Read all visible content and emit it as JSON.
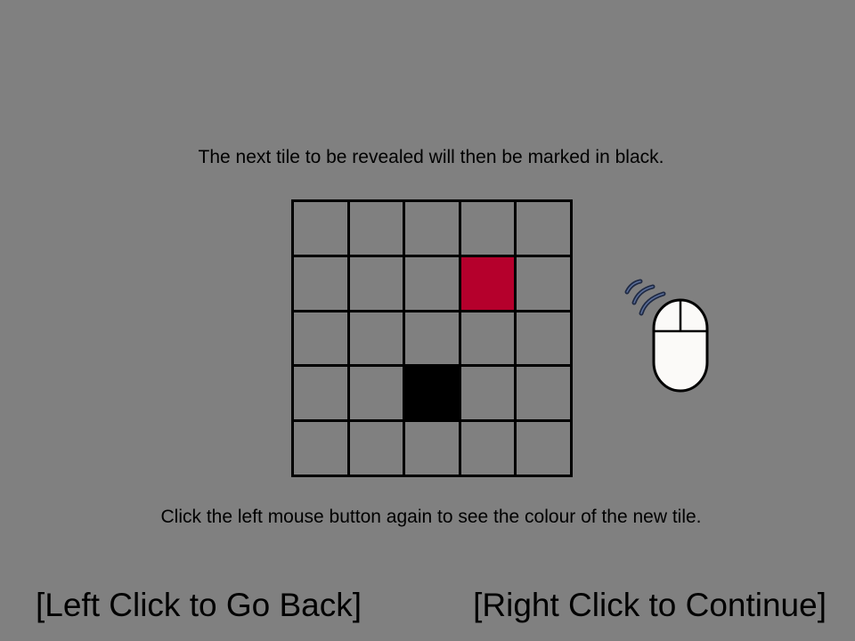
{
  "instructions": {
    "top": "The next tile to be revealed will then be marked in black.",
    "bottom": "Click the left mouse button again to see the colour of the new tile."
  },
  "grid": {
    "rows": 5,
    "cols": 5,
    "cells": [
      [
        "empty",
        "empty",
        "empty",
        "empty",
        "empty"
      ],
      [
        "empty",
        "empty",
        "empty",
        "red",
        "empty"
      ],
      [
        "empty",
        "empty",
        "empty",
        "empty",
        "empty"
      ],
      [
        "empty",
        "empty",
        "black",
        "empty",
        "empty"
      ],
      [
        "empty",
        "empty",
        "empty",
        "empty",
        "empty"
      ]
    ]
  },
  "colors": {
    "background": "#808080",
    "revealed_tile": "#b5002c",
    "next_tile": "#000000",
    "mouse_body": "#fbfaf8",
    "click_waves": "#1f2a44"
  },
  "mouse_icon": "left-click-mouse-icon",
  "navigation": {
    "back": "[Left Click to Go Back]",
    "continue": "[Right Click to Continue]"
  }
}
